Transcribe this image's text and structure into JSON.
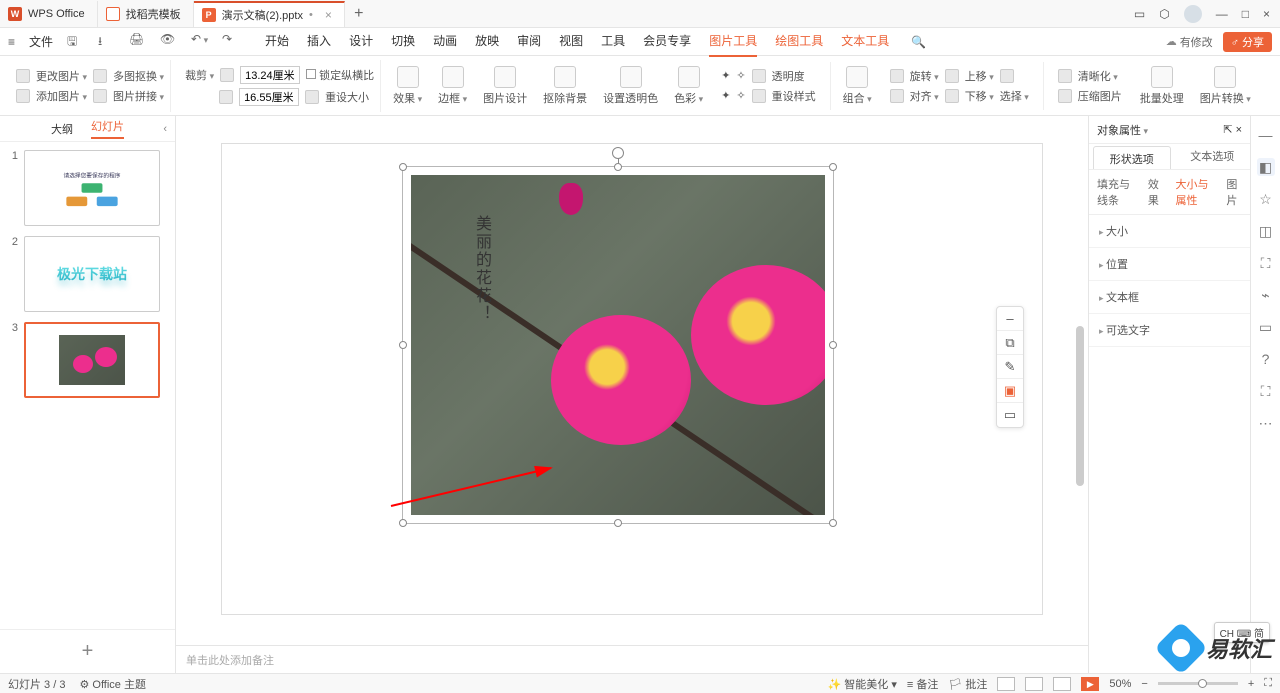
{
  "titlebar": {
    "app": "WPS Office",
    "tab_templates": "找稻壳模板",
    "doc_name": "演示文稿(2).pptx",
    "close": "×",
    "add": "+"
  },
  "menubar": {
    "hamburger": "≡",
    "file": "文件",
    "tabs": [
      "开始",
      "插入",
      "设计",
      "切换",
      "动画",
      "放映",
      "审阅",
      "视图",
      "工具",
      "会员专享",
      "图片工具",
      "绘图工具",
      "文本工具"
    ],
    "active_tab": "图片工具",
    "modified": "有修改",
    "share": "分享"
  },
  "ribbon": {
    "change_img": "更改图片",
    "add_img": "添加图片",
    "multi_crop": "多图抠换",
    "img_collage": "图片拼接",
    "crop": "裁剪",
    "width_val": "13.24厘米",
    "height_val": "16.55厘米",
    "lock_ratio": "锁定纵横比",
    "reset_size": "重设大小",
    "effect": "效果",
    "border": "边框",
    "img_design": "图片设计",
    "remove_bg": "抠除背景",
    "set_transparent": "设置透明色",
    "color": "色彩",
    "bright1": "✦",
    "bright2": "✧",
    "transparency": "透明度",
    "reset_style": "重设样式",
    "combine": "组合",
    "rotate": "旋转",
    "align": "对齐",
    "bring_fwd": "上移",
    "send_back": "下移",
    "select": "选择",
    "clarity": "清晰化",
    "compress": "压缩图片",
    "batch": "批量处理",
    "convert": "图片转换"
  },
  "slides": {
    "outline": "大纲",
    "slide": "幻灯片",
    "collapse": "‹",
    "nums": [
      "1",
      "2",
      "3"
    ],
    "t1_title": "请选择您要保存的程序",
    "t2_text": "极光下载站",
    "add": "+"
  },
  "canvas": {
    "vertical_text": "美丽的花花！",
    "float_tools": [
      "–",
      "⧉",
      "✎",
      "▣",
      "▭"
    ],
    "notes_placeholder": "单击此处添加备注"
  },
  "right": {
    "title": "对象属性",
    "pin": "⇱",
    "close": "×",
    "shape_opts": "形状选项",
    "text_opts": "文本选项",
    "sub": [
      "填充与线条",
      "效果",
      "大小与属性",
      "图片"
    ],
    "sub_active": "大小与属性",
    "sections": [
      "大小",
      "位置",
      "文本框",
      "可选文字"
    ]
  },
  "iconstrip": [
    "—",
    "◧",
    "☆",
    "◫",
    "⛶",
    "⌁",
    "▭",
    "?",
    "⛶",
    "⋯"
  ],
  "status": {
    "slide_pos": "幻灯片 3 / 3",
    "theme": "Office 主题",
    "smart_beauty": "智能美化",
    "notes": "备注",
    "comments": "批注",
    "zoom": "50%",
    "fit": "⛶"
  },
  "ime": "CH ⌨ 简",
  "watermark": "易软汇"
}
